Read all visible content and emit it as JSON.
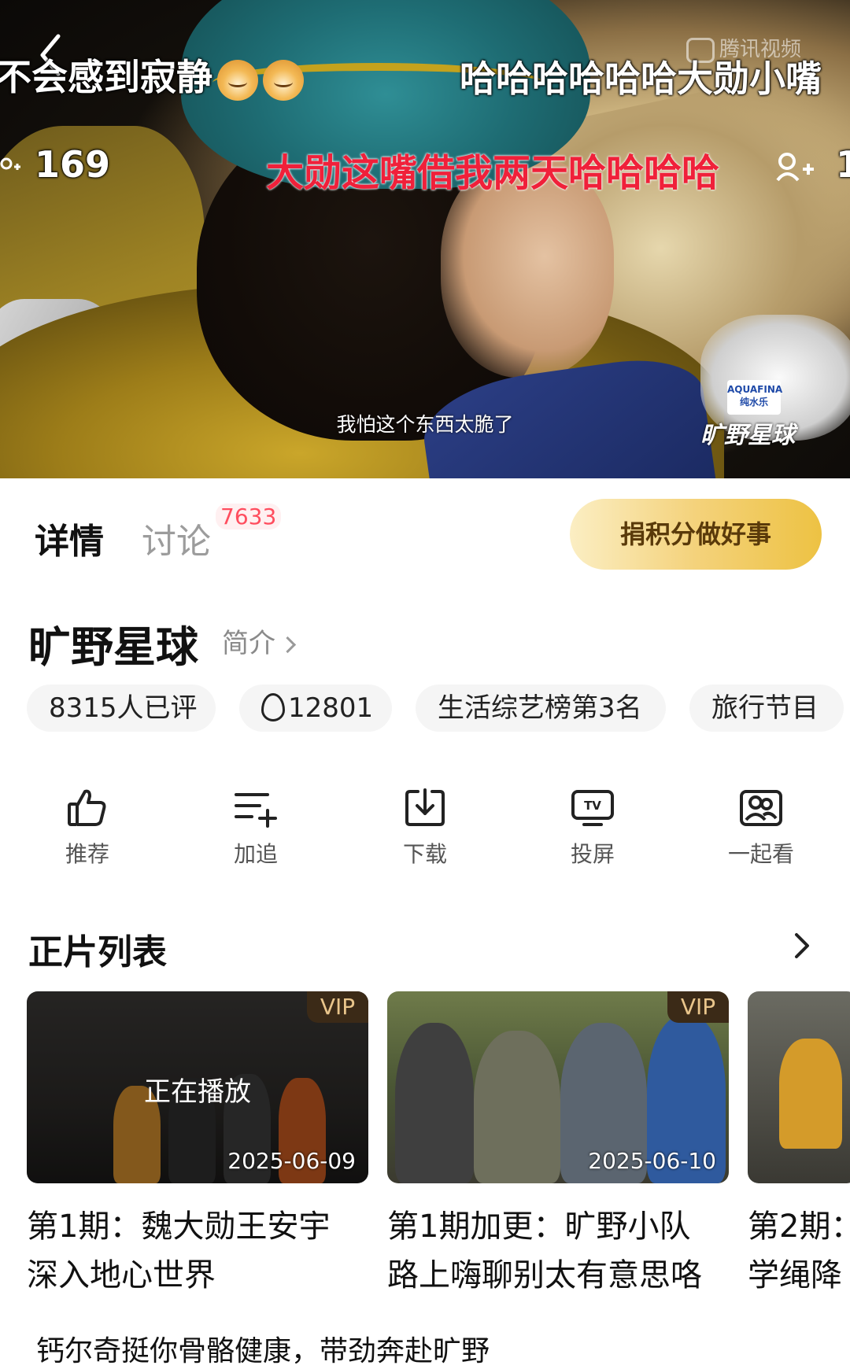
{
  "player": {
    "danmu": [
      "不会感到寂静",
      "哈哈哈哈哈哈大勋小嘴",
      "169",
      "大勋这嘴借我两天哈哈哈哈",
      "1"
    ],
    "watermark": "腾讯视频",
    "subtitle": "我怕这个东西太脆了",
    "sponsor": "AQUAFINA 纯水乐",
    "show_logo": "旷野星球"
  },
  "tabs": {
    "details": "详情",
    "discuss": "讨论",
    "discuss_count": "7633"
  },
  "donate_button": "捐积分做好事",
  "show": {
    "title": "旷野星球",
    "intro_link": "简介"
  },
  "tags": [
    "8315人已评",
    "12801",
    "生活综艺榜第3名",
    "旅行节目"
  ],
  "actions": [
    {
      "label": "推荐",
      "icon": "thumbs-up-icon"
    },
    {
      "label": "加追",
      "icon": "add-to-list-icon"
    },
    {
      "label": "下载",
      "icon": "download-icon"
    },
    {
      "label": "投屏",
      "icon": "tv-cast-icon"
    },
    {
      "label": "一起看",
      "icon": "watch-together-icon"
    }
  ],
  "episodes_section": {
    "title": "正片列表",
    "episodes": [
      {
        "badge": "VIP",
        "status": "正在播放",
        "date": "2025-06-09",
        "title_line1": "第1期：魏大勋王安宇",
        "title_line2": "深入地心世界"
      },
      {
        "badge": "VIP",
        "date": "2025-06-10",
        "title_line1": "第1期加更：旷野小队",
        "title_line2": "路上嗨聊别太有意思咯"
      },
      {
        "title_line1": "第2期：",
        "title_line2": "学绳降"
      }
    ]
  },
  "ad_line": "钙尔奇挺你骨骼健康，带劲奔赴旷野"
}
